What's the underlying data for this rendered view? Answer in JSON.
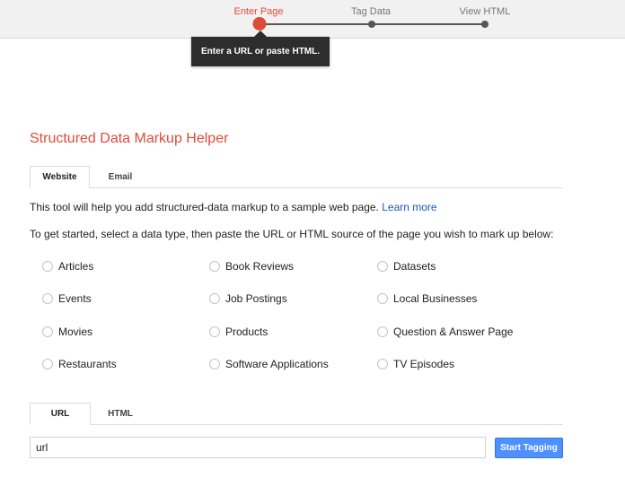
{
  "stepper": {
    "steps": [
      {
        "label": "Enter Page"
      },
      {
        "label": "Tag Data"
      },
      {
        "label": "View HTML"
      }
    ],
    "tooltip": "Enter a URL or paste HTML."
  },
  "main": {
    "title": "Structured Data Markup Helper",
    "source_tabs": [
      {
        "label": "Website"
      },
      {
        "label": "Email"
      }
    ],
    "intro_text": "This tool will help you add structured-data markup to a sample web page.",
    "learn_more_link": "Learn more",
    "instruction_text": "To get started, select a data type, then paste the URL or HTML source of the page you wish to mark up below:",
    "data_types": [
      "Articles",
      "Book Reviews",
      "Datasets",
      "Events",
      "Job Postings",
      "Local Businesses",
      "Movies",
      "Products",
      "Question & Answer Page",
      "Restaurants",
      "Software Applications",
      "TV Episodes"
    ],
    "input_tabs": [
      {
        "label": "URL"
      },
      {
        "label": "HTML"
      }
    ],
    "url_input": {
      "value": "url",
      "placeholder": ""
    },
    "start_button": "Start Tagging"
  },
  "colors": {
    "accent": "#dd4b39",
    "link": "#1a56c8",
    "button": "#4d90fe"
  }
}
